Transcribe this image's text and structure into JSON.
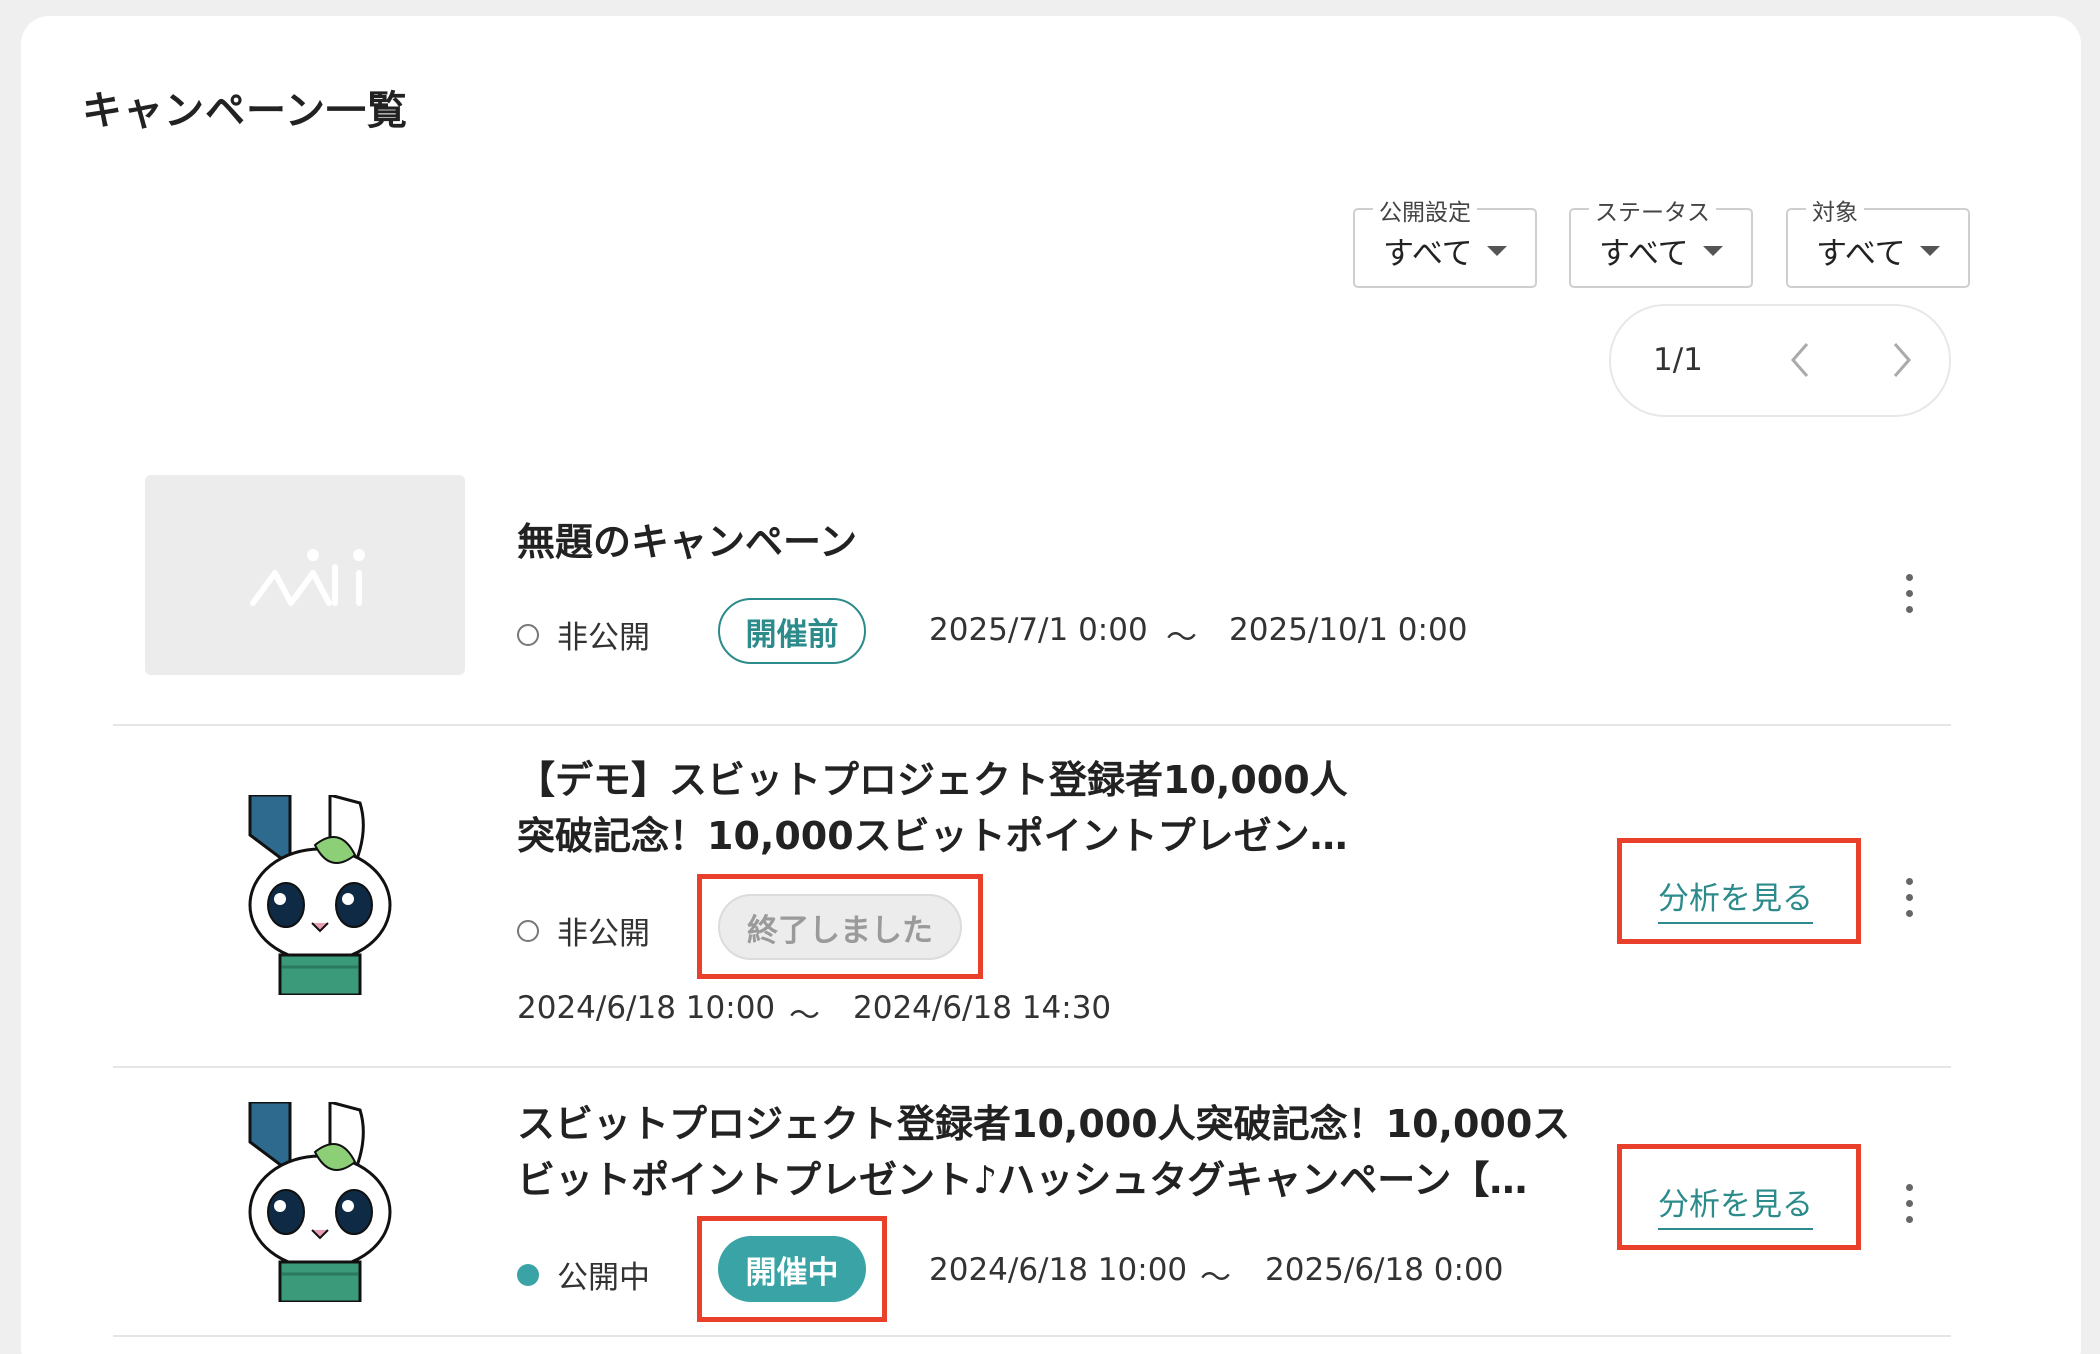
{
  "page": {
    "title": "キャンペーン一覧"
  },
  "filters": [
    {
      "label": "公開設定",
      "value": "すべて"
    },
    {
      "label": "ステータス",
      "value": "すべて"
    },
    {
      "label": "対象",
      "value": "すべて"
    }
  ],
  "pagination": {
    "text": "1/1"
  },
  "campaigns": [
    {
      "title": "無題のキャンペーン",
      "visibility": "非公開",
      "status": "開催前",
      "start": "2025/7/1 0:00",
      "separator": "〜",
      "end": "2025/10/1 0:00"
    },
    {
      "title_line1": "【デモ】スビットプロジェクト登録者10,000人",
      "title_line2": "突破記念！10,000スビットポイントプレゼン…",
      "visibility": "非公開",
      "status": "終了しました",
      "start": "2024/6/18 10:00",
      "separator": "〜",
      "end": "2024/6/18 14:30",
      "analysis_label": "分析を見る"
    },
    {
      "title_line1": "スビットプロジェクト登録者10,000人突破記念！10,000ス",
      "title_line2": "ビットポイントプレゼント♪ハッシュタグキャンペーン【…",
      "visibility": "公開中",
      "status": "開催中",
      "start": "2024/6/18 10:00",
      "separator": "〜",
      "end": "2025/6/18 0:00",
      "analysis_label": "分析を見る"
    }
  ],
  "colors": {
    "accent": "#2d8b8b",
    "live_badge": "#3aa3a5",
    "highlight": "#e8402a"
  },
  "icons": [
    "caret-down-icon",
    "chevron-left-icon",
    "chevron-right-icon",
    "kebab-menu-icon",
    "mi-logo-placeholder",
    "rabbit-mascot"
  ]
}
